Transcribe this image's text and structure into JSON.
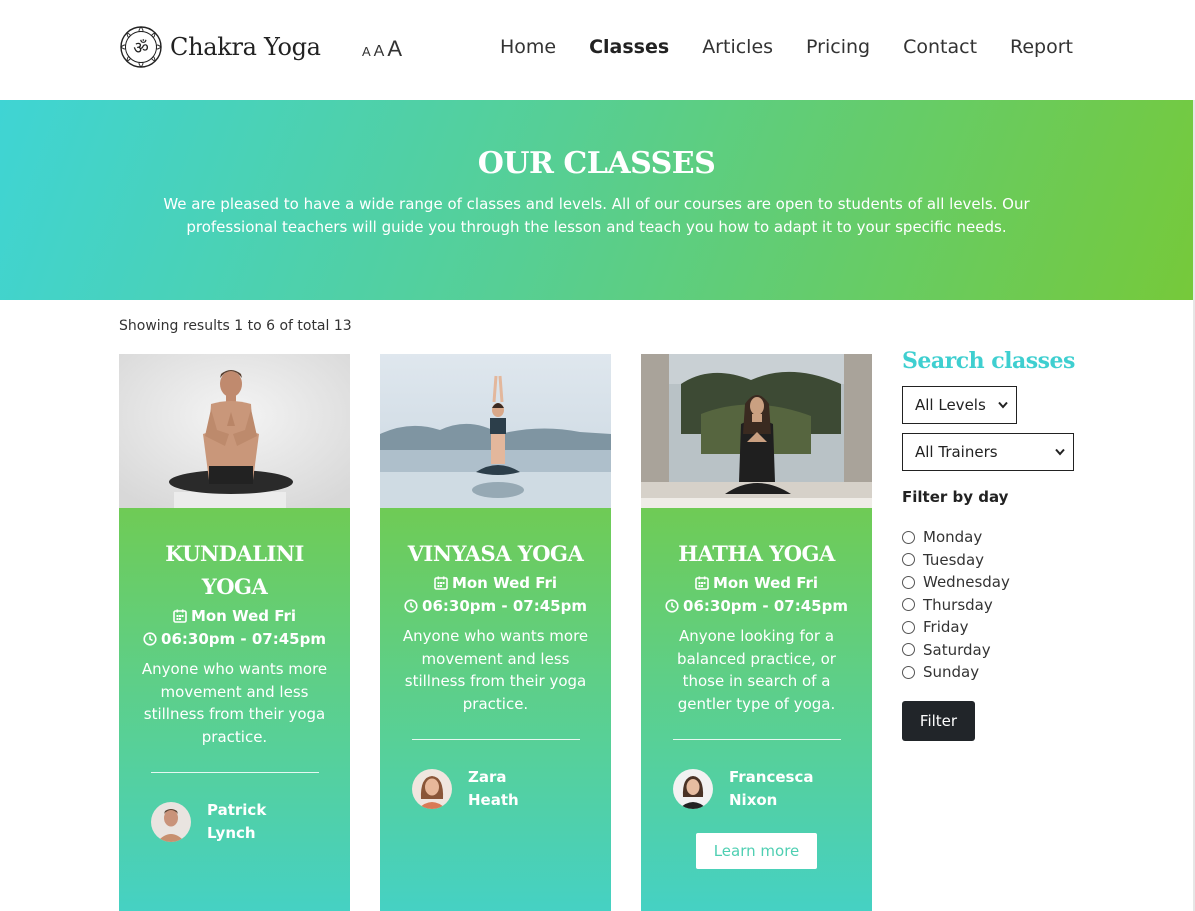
{
  "brand": {
    "name": "Chakra Yoga",
    "symbol": "ॐ"
  },
  "font_sizer": [
    "A",
    "A",
    "A"
  ],
  "nav": [
    {
      "label": "Home",
      "active": false
    },
    {
      "label": "Classes",
      "active": true
    },
    {
      "label": "Articles",
      "active": false
    },
    {
      "label": "Pricing",
      "active": false
    },
    {
      "label": "Contact",
      "active": false
    },
    {
      "label": "Report",
      "active": false
    }
  ],
  "hero": {
    "title": "OUR CLASSES",
    "text": "We are pleased to have a wide range of classes and levels. All of our courses are open to students of all levels. Our professional teachers will guide you through the lesson and teach you how to adapt it to your specific needs."
  },
  "results_text": "Showing results 1 to 6 of total 13",
  "classes": [
    {
      "title": "KUNDALINI YOGA",
      "days": "Mon Wed Fri",
      "time": "06:30pm - 07:45pm",
      "description": "Anyone who wants more movement and less stillness from their yoga practice.",
      "trainer": "Patrick Lynch"
    },
    {
      "title": "VINYASA YOGA",
      "days": "Mon Wed Fri",
      "time": "06:30pm - 07:45pm",
      "description": "Anyone who wants more movement and less stillness from their yoga practice.",
      "trainer": "Zara Heath"
    },
    {
      "title": "HATHA YOGA",
      "days": "Mon Wed Fri",
      "time": "06:30pm - 07:45pm",
      "description": "Anyone looking for a balanced practice, or those in search of a gentler type of yoga.",
      "trainer": "Francesca Nixon",
      "cta": "Learn more"
    }
  ],
  "sidebar": {
    "title": "Search classes",
    "level_select": "All Levels",
    "trainer_select": "All Trainers",
    "filter_label": "Filter by day",
    "days": [
      "Monday",
      "Tuesday",
      "Wednesday",
      "Thursday",
      "Friday",
      "Saturday",
      "Sunday"
    ],
    "filter_button": "Filter"
  },
  "colors": {
    "accent_teal": "#3fcfd0",
    "accent_green": "#76c93a",
    "dark_button": "#212529"
  }
}
